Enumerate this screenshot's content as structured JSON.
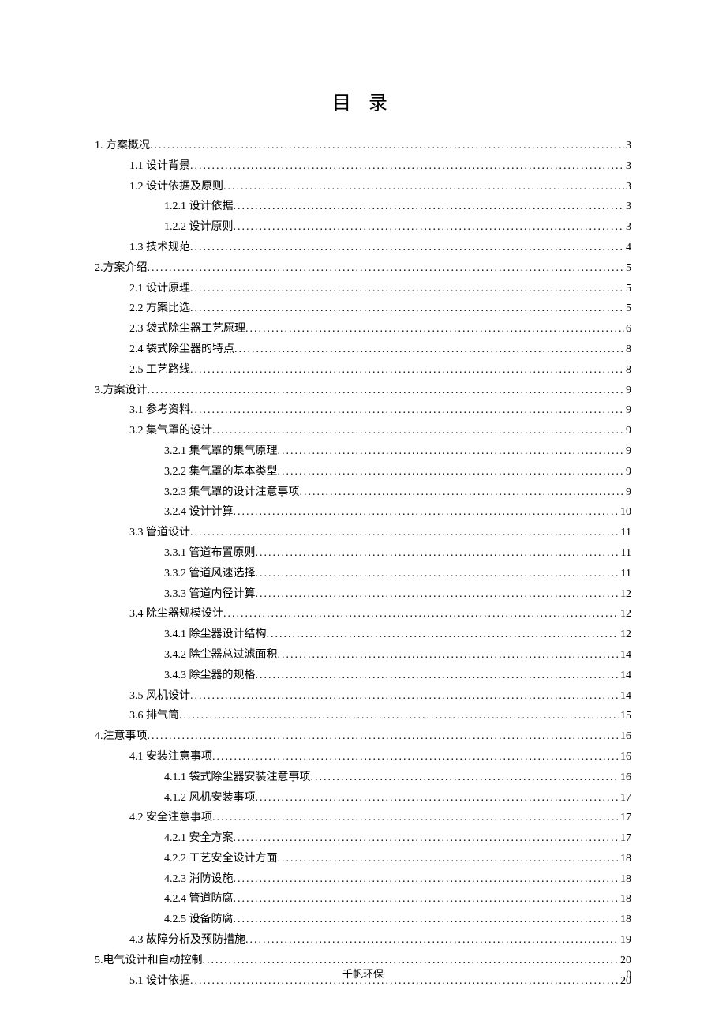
{
  "title": "目 录",
  "footer_center": "千帆环保",
  "footer_right": "0",
  "entries": [
    {
      "level": 0,
      "label": "1. 方案概况",
      "page": "3"
    },
    {
      "level": 1,
      "label": "1.1 设计背景",
      "page": "3"
    },
    {
      "level": 1,
      "label": "1.2 设计依据及原则",
      "page": "3"
    },
    {
      "level": 2,
      "label": "1.2.1 设计依据",
      "page": "3"
    },
    {
      "level": 2,
      "label": "1.2.2 设计原则",
      "page": "3"
    },
    {
      "level": 1,
      "label": "1.3 技术规范",
      "page": "4"
    },
    {
      "level": 0,
      "label": "2.方案介绍",
      "page": "5"
    },
    {
      "level": 1,
      "label": "2.1 设计原理",
      "page": "5"
    },
    {
      "level": 1,
      "label": "2.2 方案比选",
      "page": "5"
    },
    {
      "level": 1,
      "label": "2.3 袋式除尘器工艺原理",
      "page": "6"
    },
    {
      "level": 1,
      "label": "2.4 袋式除尘器的特点",
      "page": "8"
    },
    {
      "level": 1,
      "label": "2.5 工艺路线",
      "page": "8"
    },
    {
      "level": 0,
      "label": "3.方案设计",
      "page": "9"
    },
    {
      "level": 1,
      "label": "3.1 参考资料",
      "page": "9"
    },
    {
      "level": 1,
      "label": "3.2 集气罩的设计",
      "page": "9"
    },
    {
      "level": 2,
      "label": "3.2.1 集气罩的集气原理",
      "page": "9"
    },
    {
      "level": 2,
      "label": "3.2.2 集气罩的基本类型",
      "page": "9"
    },
    {
      "level": 2,
      "label": "3.2.3 集气罩的设计注意事项",
      "page": "9"
    },
    {
      "level": 2,
      "label": "3.2.4 设计计算",
      "page": "10"
    },
    {
      "level": 1,
      "label": "3.3 管道设计",
      "page": "11"
    },
    {
      "level": 2,
      "label": "3.3.1 管道布置原则",
      "page": "11"
    },
    {
      "level": 2,
      "label": "3.3.2 管道风速选择",
      "page": "11"
    },
    {
      "level": 2,
      "label": "3.3.3 管道内径计算",
      "page": "12"
    },
    {
      "level": 1,
      "label": "3.4 除尘器规模设计",
      "page": "12"
    },
    {
      "level": 2,
      "label": "3.4.1 除尘器设计结构",
      "page": "12"
    },
    {
      "level": 2,
      "label": "3.4.2 除尘器总过滤面积",
      "page": "14"
    },
    {
      "level": 2,
      "label": "3.4.3 除尘器的规格",
      "page": "14"
    },
    {
      "level": 1,
      "label": "3.5 风机设计",
      "page": "14"
    },
    {
      "level": 1,
      "label": "3.6 排气筒",
      "page": "15"
    },
    {
      "level": 0,
      "label": "4.注意事项",
      "page": "16"
    },
    {
      "level": 1,
      "label": "4.1 安装注意事项",
      "page": "16"
    },
    {
      "level": 2,
      "label": "4.1.1 袋式除尘器安装注意事项",
      "page": "16"
    },
    {
      "level": 2,
      "label": "4.1.2 风机安装事项",
      "page": "17"
    },
    {
      "level": 1,
      "label": "4.2 安全注意事项",
      "page": "17"
    },
    {
      "level": 2,
      "label": "4.2.1 安全方案",
      "page": "17"
    },
    {
      "level": 2,
      "label": "4.2.2 工艺安全设计方面",
      "page": "18"
    },
    {
      "level": 2,
      "label": "4.2.3 消防设施",
      "page": "18"
    },
    {
      "level": 2,
      "label": "4.2.4 管道防腐",
      "page": "18"
    },
    {
      "level": 2,
      "label": "4.2.5 设备防腐",
      "page": "18"
    },
    {
      "level": 1,
      "label": "4.3 故障分析及预防措施",
      "page": "19"
    },
    {
      "level": 0,
      "label": "5.电气设计和自动控制",
      "page": "20"
    },
    {
      "level": 1,
      "label": "5.1 设计依据 ",
      "page": "20"
    }
  ]
}
